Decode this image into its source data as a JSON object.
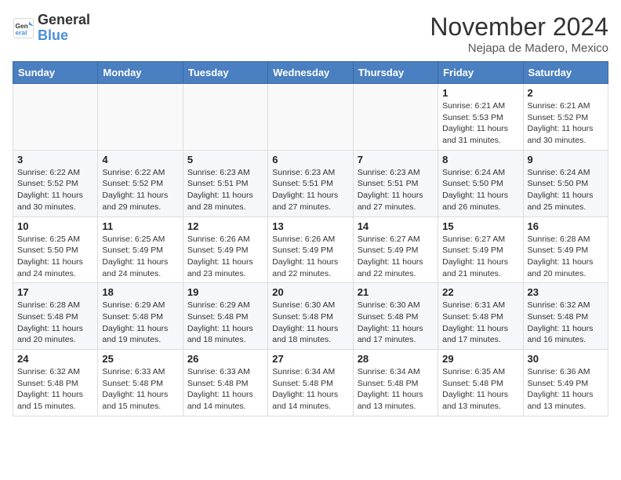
{
  "header": {
    "logo_line1": "General",
    "logo_line2": "Blue",
    "month": "November 2024",
    "location": "Nejapa de Madero, Mexico"
  },
  "weekdays": [
    "Sunday",
    "Monday",
    "Tuesday",
    "Wednesday",
    "Thursday",
    "Friday",
    "Saturday"
  ],
  "weeks": [
    [
      {
        "day": "",
        "info": ""
      },
      {
        "day": "",
        "info": ""
      },
      {
        "day": "",
        "info": ""
      },
      {
        "day": "",
        "info": ""
      },
      {
        "day": "",
        "info": ""
      },
      {
        "day": "1",
        "info": "Sunrise: 6:21 AM\nSunset: 5:53 PM\nDaylight: 11 hours and 31 minutes."
      },
      {
        "day": "2",
        "info": "Sunrise: 6:21 AM\nSunset: 5:52 PM\nDaylight: 11 hours and 30 minutes."
      }
    ],
    [
      {
        "day": "3",
        "info": "Sunrise: 6:22 AM\nSunset: 5:52 PM\nDaylight: 11 hours and 30 minutes."
      },
      {
        "day": "4",
        "info": "Sunrise: 6:22 AM\nSunset: 5:52 PM\nDaylight: 11 hours and 29 minutes."
      },
      {
        "day": "5",
        "info": "Sunrise: 6:23 AM\nSunset: 5:51 PM\nDaylight: 11 hours and 28 minutes."
      },
      {
        "day": "6",
        "info": "Sunrise: 6:23 AM\nSunset: 5:51 PM\nDaylight: 11 hours and 27 minutes."
      },
      {
        "day": "7",
        "info": "Sunrise: 6:23 AM\nSunset: 5:51 PM\nDaylight: 11 hours and 27 minutes."
      },
      {
        "day": "8",
        "info": "Sunrise: 6:24 AM\nSunset: 5:50 PM\nDaylight: 11 hours and 26 minutes."
      },
      {
        "day": "9",
        "info": "Sunrise: 6:24 AM\nSunset: 5:50 PM\nDaylight: 11 hours and 25 minutes."
      }
    ],
    [
      {
        "day": "10",
        "info": "Sunrise: 6:25 AM\nSunset: 5:50 PM\nDaylight: 11 hours and 24 minutes."
      },
      {
        "day": "11",
        "info": "Sunrise: 6:25 AM\nSunset: 5:49 PM\nDaylight: 11 hours and 24 minutes."
      },
      {
        "day": "12",
        "info": "Sunrise: 6:26 AM\nSunset: 5:49 PM\nDaylight: 11 hours and 23 minutes."
      },
      {
        "day": "13",
        "info": "Sunrise: 6:26 AM\nSunset: 5:49 PM\nDaylight: 11 hours and 22 minutes."
      },
      {
        "day": "14",
        "info": "Sunrise: 6:27 AM\nSunset: 5:49 PM\nDaylight: 11 hours and 22 minutes."
      },
      {
        "day": "15",
        "info": "Sunrise: 6:27 AM\nSunset: 5:49 PM\nDaylight: 11 hours and 21 minutes."
      },
      {
        "day": "16",
        "info": "Sunrise: 6:28 AM\nSunset: 5:49 PM\nDaylight: 11 hours and 20 minutes."
      }
    ],
    [
      {
        "day": "17",
        "info": "Sunrise: 6:28 AM\nSunset: 5:48 PM\nDaylight: 11 hours and 20 minutes."
      },
      {
        "day": "18",
        "info": "Sunrise: 6:29 AM\nSunset: 5:48 PM\nDaylight: 11 hours and 19 minutes."
      },
      {
        "day": "19",
        "info": "Sunrise: 6:29 AM\nSunset: 5:48 PM\nDaylight: 11 hours and 18 minutes."
      },
      {
        "day": "20",
        "info": "Sunrise: 6:30 AM\nSunset: 5:48 PM\nDaylight: 11 hours and 18 minutes."
      },
      {
        "day": "21",
        "info": "Sunrise: 6:30 AM\nSunset: 5:48 PM\nDaylight: 11 hours and 17 minutes."
      },
      {
        "day": "22",
        "info": "Sunrise: 6:31 AM\nSunset: 5:48 PM\nDaylight: 11 hours and 17 minutes."
      },
      {
        "day": "23",
        "info": "Sunrise: 6:32 AM\nSunset: 5:48 PM\nDaylight: 11 hours and 16 minutes."
      }
    ],
    [
      {
        "day": "24",
        "info": "Sunrise: 6:32 AM\nSunset: 5:48 PM\nDaylight: 11 hours and 15 minutes."
      },
      {
        "day": "25",
        "info": "Sunrise: 6:33 AM\nSunset: 5:48 PM\nDaylight: 11 hours and 15 minutes."
      },
      {
        "day": "26",
        "info": "Sunrise: 6:33 AM\nSunset: 5:48 PM\nDaylight: 11 hours and 14 minutes."
      },
      {
        "day": "27",
        "info": "Sunrise: 6:34 AM\nSunset: 5:48 PM\nDaylight: 11 hours and 14 minutes."
      },
      {
        "day": "28",
        "info": "Sunrise: 6:34 AM\nSunset: 5:48 PM\nDaylight: 11 hours and 13 minutes."
      },
      {
        "day": "29",
        "info": "Sunrise: 6:35 AM\nSunset: 5:48 PM\nDaylight: 11 hours and 13 minutes."
      },
      {
        "day": "30",
        "info": "Sunrise: 6:36 AM\nSunset: 5:49 PM\nDaylight: 11 hours and 13 minutes."
      }
    ]
  ]
}
